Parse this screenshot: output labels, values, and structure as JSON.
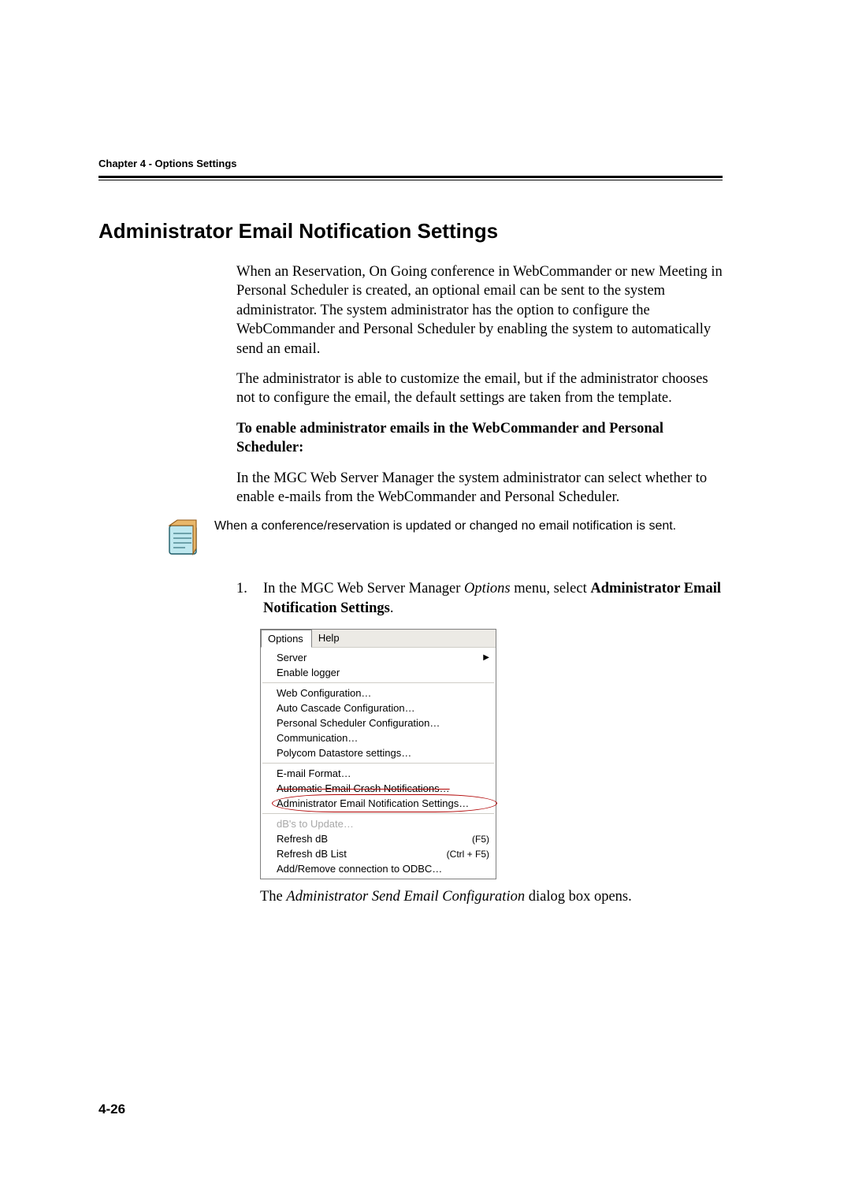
{
  "header": {
    "chapter": "Chapter 4 - Options Settings"
  },
  "title": "Administrator Email Notification Settings",
  "p1": "When an Reservation, On Going conference in WebCommander or new Meeting in Personal Scheduler is created, an optional email can be sent to the system administrator. The system administrator has the option to configure the WebCommander and Personal Scheduler by enabling the system to automatically send an email.",
  "p2": "The administrator is able to customize the email, but if the administrator chooses not to configure the email, the default settings are taken from the template.",
  "p3_bold": "To enable administrator emails in the WebCommander and Personal Scheduler:",
  "p4": "In the MGC Web Server Manager the system administrator can select whether to enable e-mails from the WebCommander and Personal Scheduler.",
  "note": "When a conference/reservation is updated or changed no email notification is sent.",
  "step1_pre": "In the MGC Web Server Manager ",
  "step1_ital": "Options",
  "step1_mid": " menu, select ",
  "step1_bold": "Administrator Email Notification Settings",
  "step1_post": ".",
  "menu": {
    "bar": {
      "options": "Options",
      "help": "Help"
    },
    "items": {
      "server": "Server",
      "enable_logger": "Enable logger",
      "web_config": "Web Configuration…",
      "auto_cascade": "Auto Cascade Configuration…",
      "personal_sched": "Personal Scheduler Configuration…",
      "communication": "Communication…",
      "polycom_ds": "Polycom Datastore settings…",
      "email_format": "E-mail Format…",
      "auto_crash": "Automatic Email Crash  Notifications…",
      "admin_email": "Administrator Email Notification Settings…",
      "dbs_update": "dB's to Update…",
      "refresh_db": "Refresh dB",
      "refresh_db_list": "Refresh dB List",
      "add_remove_odbc": "Add/Remove connection to ODBC…"
    },
    "shortcuts": {
      "f5": "(F5)",
      "ctrl_f5": "(Ctrl + F5)"
    }
  },
  "caption_pre": "The ",
  "caption_ital": "Administrator Send Email Configuration",
  "caption_post": " dialog box opens.",
  "page_num": "4-26",
  "step_num": "1."
}
